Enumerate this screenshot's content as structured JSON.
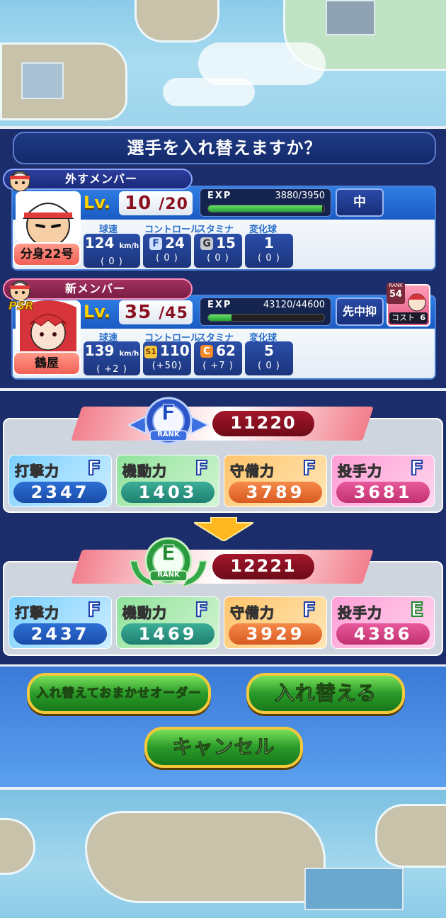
{
  "dialog": {
    "title": "選手を入れ替えますか？"
  },
  "outgoing": {
    "label": "外すメンバー",
    "name": "分身22号",
    "lv_label": "Lv.",
    "level": "10",
    "level_max": "/20",
    "exp_label": "EXP",
    "exp_value": "3880/3950",
    "exp_fraction": 0.98,
    "position": "中",
    "stats": {
      "headers": [
        "球速",
        "コントロール",
        "スタミナ",
        "変化球"
      ],
      "speed": {
        "value": "124",
        "unit": "km/h",
        "diff": "( 0 )"
      },
      "control": {
        "grade": "F",
        "value": "24",
        "diff": "( 0 )"
      },
      "stamina": {
        "grade": "G",
        "value": "15",
        "diff": "( 0 )"
      },
      "breaking": {
        "value": "1",
        "diff": "( 0 )"
      }
    }
  },
  "incoming": {
    "label": "新メンバー",
    "name": "鶴屋",
    "rarity": "PSR",
    "lv_label": "Lv.",
    "level": "35",
    "level_max": "/45",
    "exp_label": "EXP",
    "exp_value": "43120/44600",
    "exp_fraction": 0.2,
    "position": "先中抑",
    "rank_label": "RANK",
    "rank": "54",
    "cost_label": "コスト",
    "cost": "6",
    "stats": {
      "headers": [
        "球速",
        "コントロール",
        "スタミナ",
        "変化球"
      ],
      "speed": {
        "value": "139",
        "unit": "km/h",
        "diff": "( +2 )"
      },
      "control": {
        "grade": "S1",
        "value": "110",
        "diff": "(+50)"
      },
      "stamina": {
        "grade": "C",
        "value": "62",
        "diff": "( +7 )"
      },
      "breaking": {
        "value": "5",
        "diff": "( 0 )"
      }
    }
  },
  "team_before": {
    "rank": "F",
    "rank_label": "RANK",
    "score": "11220",
    "cells": [
      {
        "label": "打撃力",
        "grade": "F",
        "value": "2347"
      },
      {
        "label": "機動力",
        "grade": "F",
        "value": "1403"
      },
      {
        "label": "守備力",
        "grade": "F",
        "value": "3789"
      },
      {
        "label": "投手力",
        "grade": "F",
        "value": "3681"
      }
    ]
  },
  "team_after": {
    "rank": "E",
    "rank_label": "RANK",
    "score": "12221",
    "cells": [
      {
        "label": "打撃力",
        "grade": "F",
        "value": "2437"
      },
      {
        "label": "機動力",
        "grade": "F",
        "value": "1469"
      },
      {
        "label": "守備力",
        "grade": "F",
        "value": "3929"
      },
      {
        "label": "投手力",
        "grade": "E",
        "value": "4386"
      }
    ]
  },
  "buttons": {
    "auto_order": "入れ替えておまかせオーダー",
    "swap": "入れ替える",
    "cancel": "キャンセル"
  },
  "colors": {
    "batting": "#3b8fe0",
    "mobility": "#3aa88c",
    "defense": "#f07a3e",
    "pitching": "#e2478a",
    "rank_f_emblem": "#3d6fe0",
    "rank_e_emblem": "#35a84a"
  }
}
